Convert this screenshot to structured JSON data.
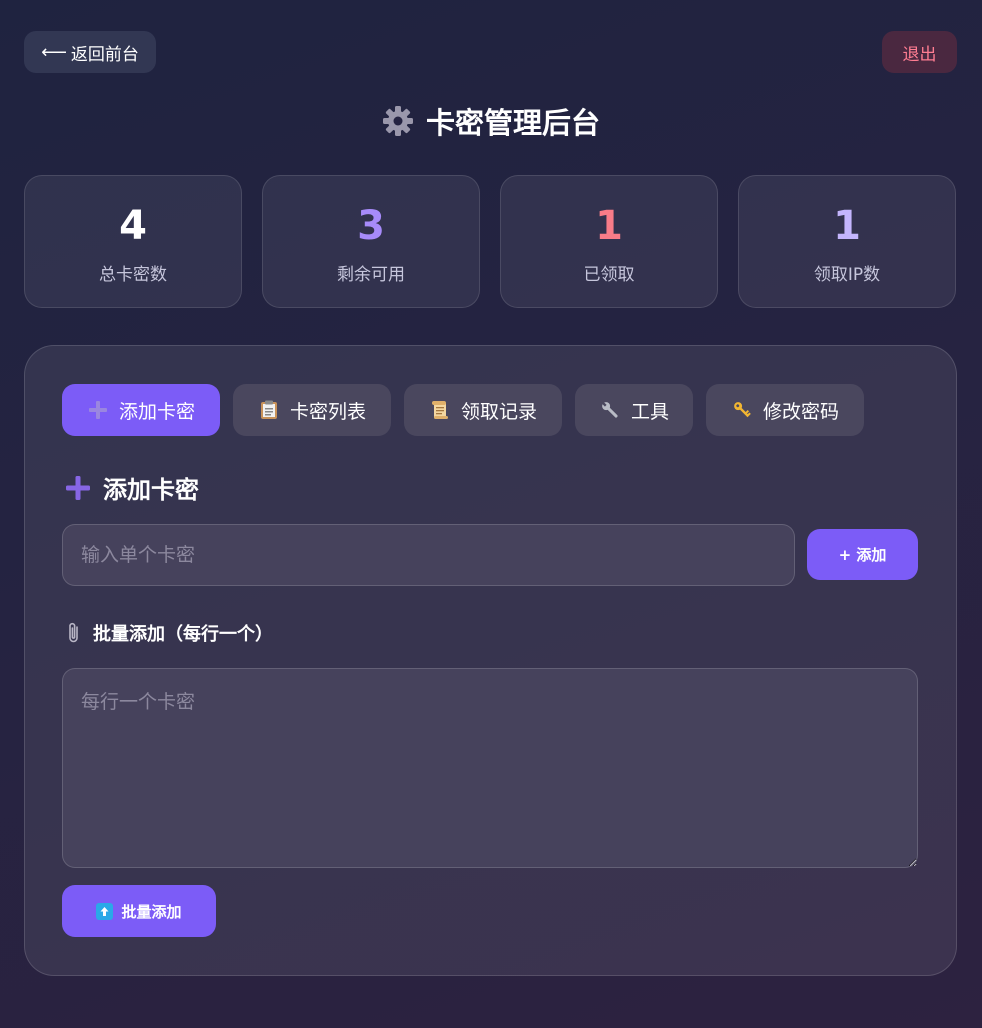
{
  "header": {
    "back_label": "返回前台",
    "logout_label": "退出",
    "title": "卡密管理后台"
  },
  "stats": [
    {
      "value": "4",
      "label": "总卡密数",
      "color": "#ffffff"
    },
    {
      "value": "3",
      "label": "剩余可用",
      "color": "#a78bfa"
    },
    {
      "value": "1",
      "label": "已领取",
      "color": "#f87c88"
    },
    {
      "value": "1",
      "label": "领取IP数",
      "color": "#c4b5fd"
    }
  ],
  "tabs": [
    {
      "label": "添加卡密",
      "icon": "plus-icon",
      "active": true
    },
    {
      "label": "卡密列表",
      "icon": "clipboard-icon",
      "active": false
    },
    {
      "label": "领取记录",
      "icon": "scroll-icon",
      "active": false
    },
    {
      "label": "工具",
      "icon": "wrench-icon",
      "active": false
    },
    {
      "label": "修改密码",
      "icon": "key-icon",
      "active": false
    }
  ],
  "add_section": {
    "title": "添加卡密",
    "single_placeholder": "输入单个卡密",
    "single_value": "",
    "add_button": "+ 添加",
    "batch_label": "批量添加（每行一个）",
    "batch_placeholder": "每行一个卡密",
    "batch_value": "",
    "batch_button": "批量添加"
  },
  "colors": {
    "accent": "#7c5cf7",
    "logout": "#ff7d92"
  }
}
